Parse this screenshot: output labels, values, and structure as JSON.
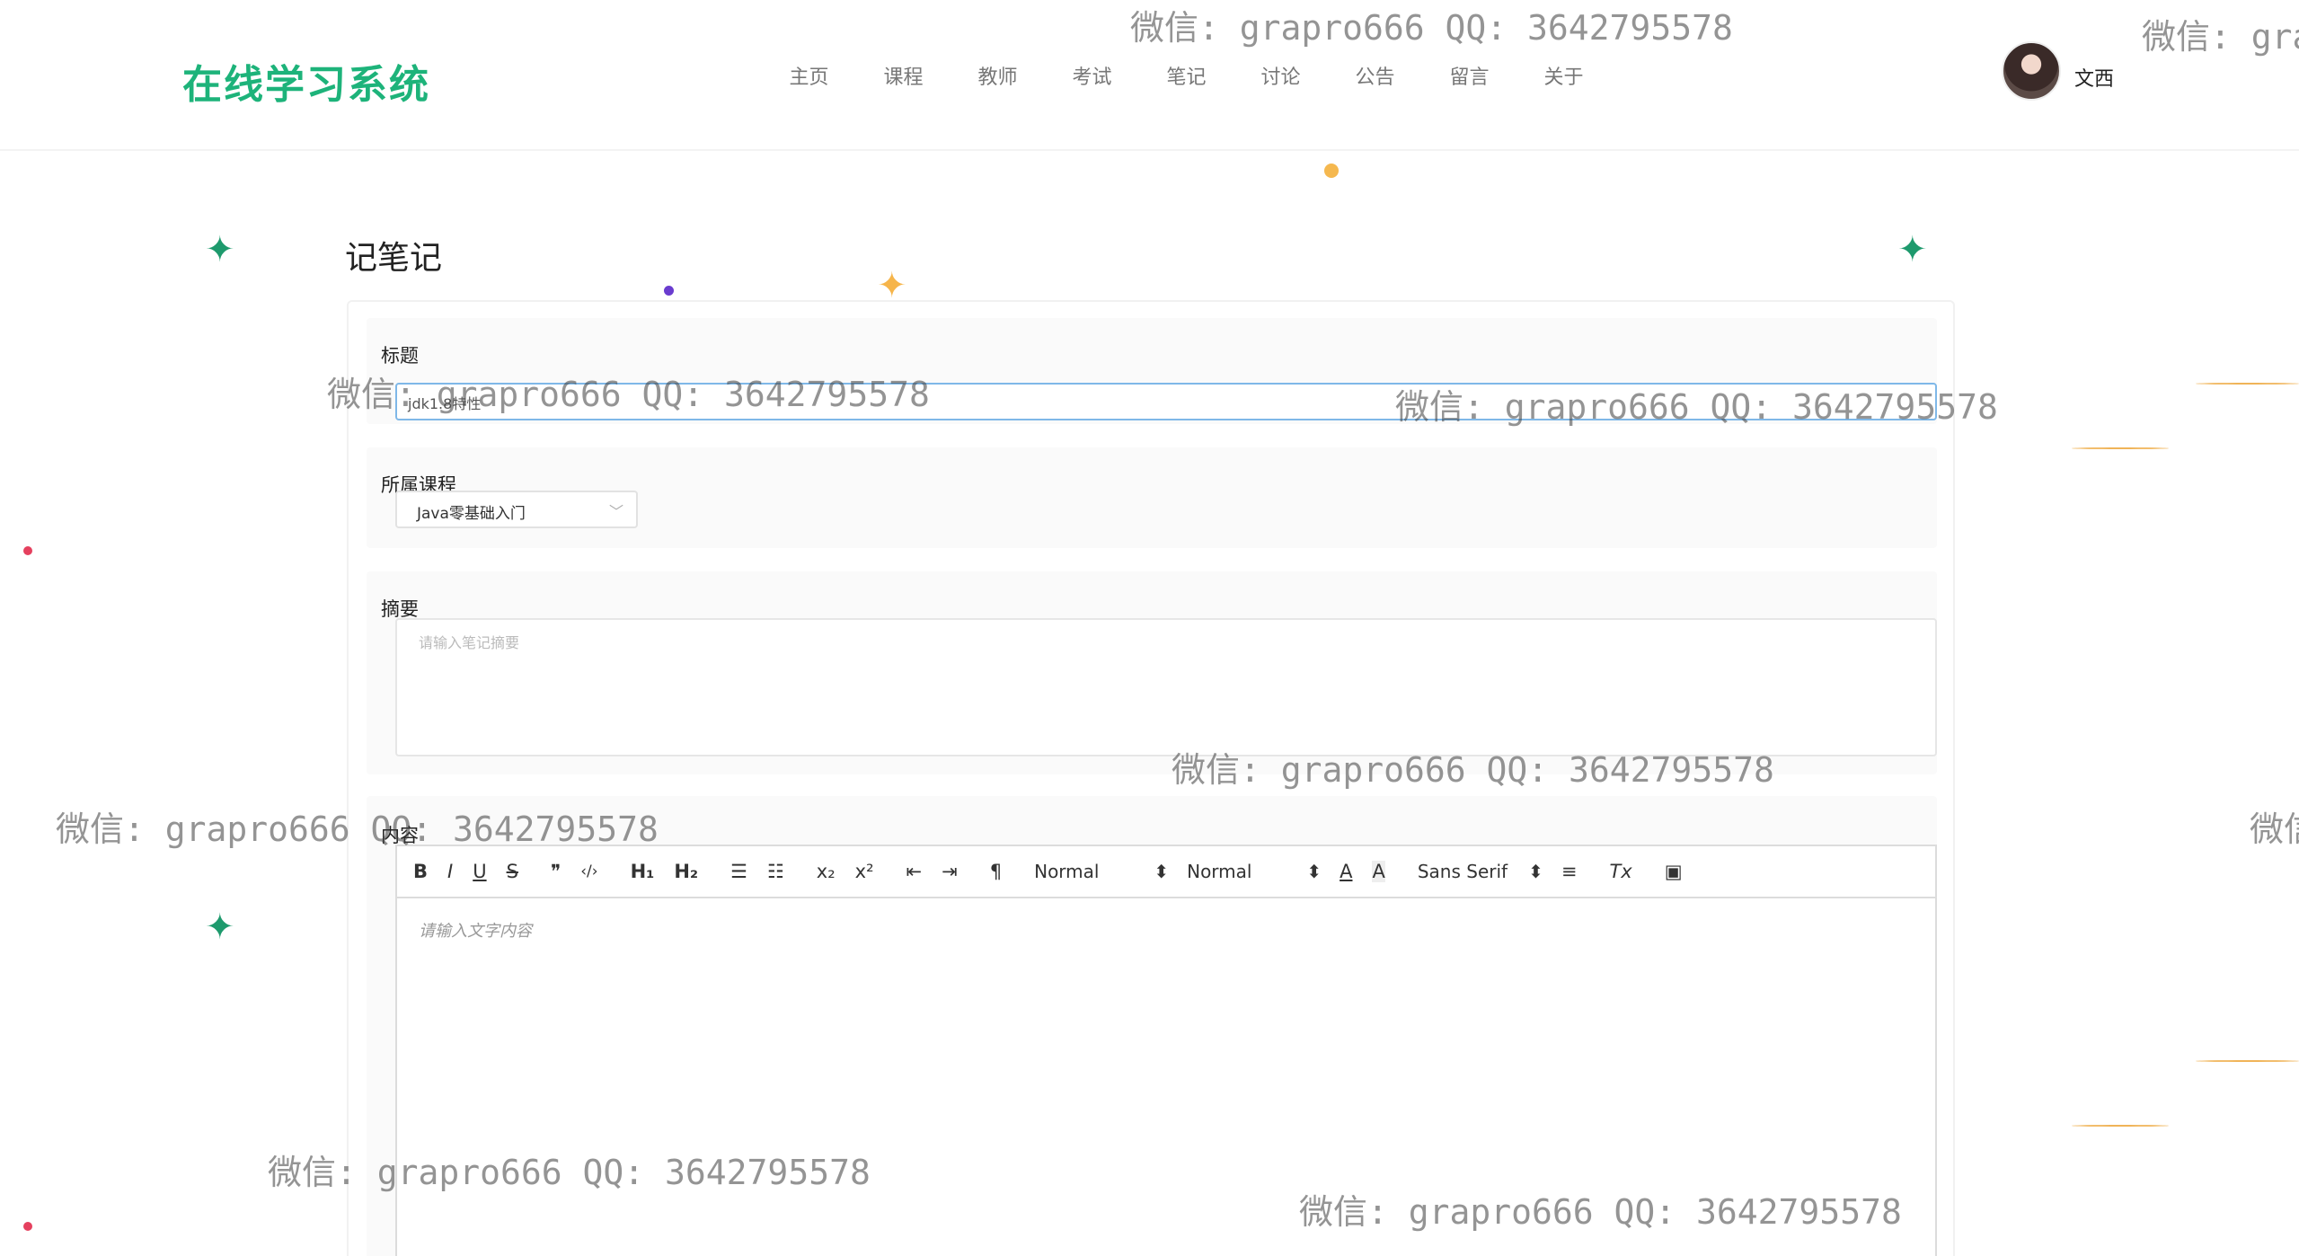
{
  "header": {
    "logo": "在线学习系统",
    "nav": [
      "主页",
      "课程",
      "教师",
      "考试",
      "笔记",
      "讨论",
      "公告",
      "留言",
      "关于"
    ],
    "username": "文西"
  },
  "page": {
    "title": "记笔记"
  },
  "form": {
    "title_label": "标题",
    "title_value": "jdk1.8特性",
    "course_label": "所属课程",
    "course_value": "Java零基础入门",
    "summary_label": "摘要",
    "summary_placeholder": "请输入笔记摘要",
    "content_label": "内容",
    "content_placeholder": "请输入文字内容"
  },
  "toolbar": {
    "bold": "B",
    "italic": "I",
    "underline": "U",
    "strike": "S",
    "quote": "❞",
    "code": "‹/›",
    "h1": "H₁",
    "h2": "H₂",
    "ordered_list": "☰",
    "bullet_list": "☷",
    "subscript": "x₂",
    "superscript": "x²",
    "outdent": "⇤",
    "indent": "⇥",
    "direction": "¶",
    "size_select": "Normal",
    "header_select": "Normal",
    "color": "A",
    "background": "A",
    "font_select": "Sans Serif",
    "align": "≡",
    "clean": "Tx",
    "image": "▣",
    "select_arrow": "⬍"
  },
  "watermark": "微信: grapro666 QQ: 3642795578",
  "colors": {
    "brand": "#1db37a",
    "spark": "#1e9a6d",
    "star": "#f6b54b"
  }
}
